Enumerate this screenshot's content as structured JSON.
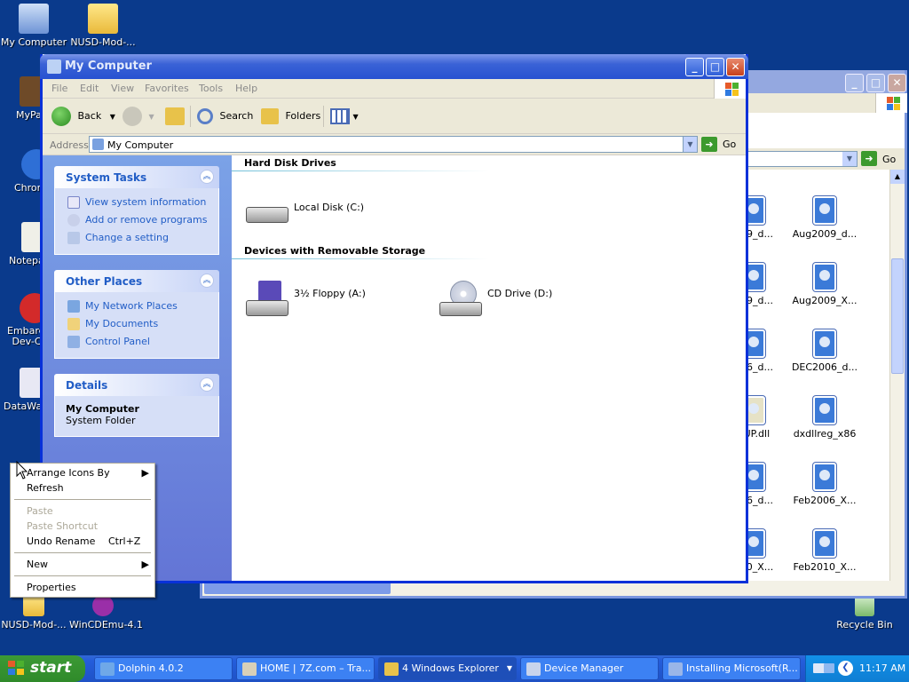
{
  "desktop": {
    "icons": [
      {
        "label": "My Computer"
      },
      {
        "label": "NUSD-Mod-..."
      },
      {
        "label": "MyPa"
      },
      {
        "label": "Chrom"
      },
      {
        "label": "Notepa"
      },
      {
        "label": "Embarca Dev-C"
      },
      {
        "label": "DataWa"
      },
      {
        "label": "NUSD-Mod-..."
      },
      {
        "label": "WinCDEmu-4.1"
      },
      {
        "label": "Recycle Bin"
      }
    ]
  },
  "back_window": {
    "files": [
      {
        "label": "009_d..."
      },
      {
        "label": "Aug2009_d..."
      },
      {
        "label": "009_d..."
      },
      {
        "label": "Aug2009_X..."
      },
      {
        "label": "006_d..."
      },
      {
        "label": "DEC2006_d..."
      },
      {
        "label": "TUP.dll"
      },
      {
        "label": "dxdllreg_x86"
      },
      {
        "label": "006_d..."
      },
      {
        "label": "Feb2006_X..."
      },
      {
        "label": "010_X..."
      },
      {
        "label": "Feb2010_X..."
      }
    ],
    "go_label": "Go"
  },
  "window": {
    "title": "My Computer",
    "menu": [
      "File",
      "Edit",
      "View",
      "Favorites",
      "Tools",
      "Help"
    ],
    "toolbar": {
      "back": "Back",
      "search": "Search",
      "folders": "Folders"
    },
    "address": {
      "label": "Address",
      "value": "My Computer",
      "go": "Go"
    }
  },
  "taskpane": {
    "system_tasks": {
      "title": "System Tasks",
      "links": [
        "View system information",
        "Add or remove programs",
        "Change a setting"
      ]
    },
    "other_places": {
      "title": "Other Places",
      "links": [
        "My Network Places",
        "My Documents",
        "Control Panel"
      ]
    },
    "details": {
      "title": "Details",
      "name": "My Computer",
      "type": "System Folder"
    }
  },
  "content": {
    "groups": [
      {
        "title": "Hard Disk Drives",
        "items": [
          "Local Disk (C:)"
        ]
      },
      {
        "title": "Devices with Removable Storage",
        "items": [
          "3½ Floppy (A:)",
          "CD Drive (D:)"
        ]
      }
    ]
  },
  "context_menu": {
    "items": [
      {
        "label": "Arrange Icons By"
      },
      {
        "label": "Refresh"
      },
      {
        "label": "Paste"
      },
      {
        "label": "Paste Shortcut"
      },
      {
        "label": "Undo Rename",
        "shortcut": "Ctrl+Z"
      },
      {
        "label": "New"
      },
      {
        "label": "Properties"
      }
    ]
  },
  "taskbar": {
    "start": "start",
    "tasks": [
      "Dolphin 4.0.2",
      "HOME | 7Z.com – Tra...",
      "4 Windows Explorer",
      "Device Manager",
      "Installing Microsoft(R..."
    ],
    "clock": "11:17 AM"
  },
  "colors": {
    "xp_blue": "#0831d9",
    "taskpane_link": "#215dc6",
    "start_green": "#3c9a35",
    "desktop": "#0a3a8c"
  }
}
